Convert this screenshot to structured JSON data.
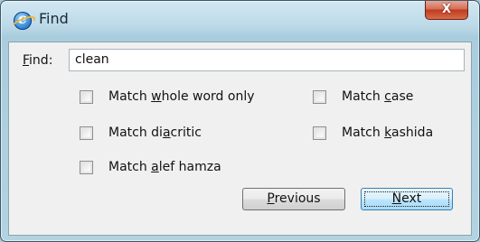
{
  "window": {
    "title": "Find",
    "close_glyph": "X"
  },
  "find": {
    "label": "Find:",
    "label_accel": "F",
    "label_rest": "ind:",
    "value": "clean"
  },
  "options": [
    {
      "pre": "Match ",
      "accel": "w",
      "post": "hole word only",
      "checked": false
    },
    {
      "pre": "Match ",
      "accel": "c",
      "post": "ase",
      "checked": false
    },
    {
      "pre": "Match di",
      "accel": "a",
      "post": "critic",
      "checked": false
    },
    {
      "pre": "Match ",
      "accel": "k",
      "post": "ashida",
      "checked": false
    },
    {
      "pre": "Match ",
      "accel": "a",
      "post": "lef hamza",
      "checked": false
    }
  ],
  "buttons": {
    "previous": {
      "accel": "P",
      "rest": "revious"
    },
    "next": {
      "accel": "N",
      "rest": "ext"
    }
  },
  "icons": {
    "app": "internet-explorer-icon",
    "close": "close-icon"
  }
}
